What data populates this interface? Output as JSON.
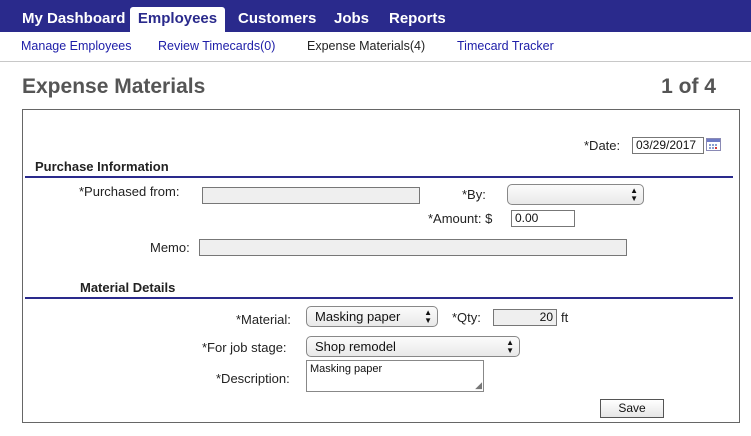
{
  "topnav": {
    "tabs": [
      {
        "label": "My Dashboard"
      },
      {
        "label": "Employees"
      },
      {
        "label": "Customers"
      },
      {
        "label": "Jobs"
      },
      {
        "label": "Reports"
      }
    ],
    "active": "Employees"
  },
  "subnav": {
    "items": [
      {
        "label": "Manage Employees"
      },
      {
        "label": "Review Timecards(0)"
      },
      {
        "label": "Expense Materials(4)"
      },
      {
        "label": "Timecard Tracker"
      }
    ],
    "active": "Expense Materials(4)"
  },
  "page": {
    "title": "Expense Materials",
    "count": "1 of 4"
  },
  "form": {
    "date_label": "*Date:",
    "date_value": "03/29/2017",
    "purchase_section": "Purchase Information",
    "purchased_from_label": "*Purchased from:",
    "purchased_from_value": "",
    "by_label": "*By:",
    "by_value": "",
    "amount_label": "*Amount: $",
    "amount_value": "0.00",
    "memo_label": "Memo:",
    "memo_value": "",
    "material_section": "Material Details",
    "material_label": "*Material:",
    "material_value": "Masking paper",
    "qty_label": "*Qty:",
    "qty_value": "20",
    "qty_unit": "ft",
    "job_stage_label": "*For job stage:",
    "job_stage_value": "Shop remodel",
    "description_label": "*Description:",
    "description_value": "Masking paper",
    "save_label": "Save"
  },
  "icons": {
    "calendar": "calendar-icon",
    "select_arrows": "updown-arrows-icon",
    "resize_grip": "resize-grip-icon"
  },
  "colors": {
    "nav_bg": "#2a2a8c",
    "link": "#1d1da8",
    "section_rule": "#2a2a8c"
  }
}
